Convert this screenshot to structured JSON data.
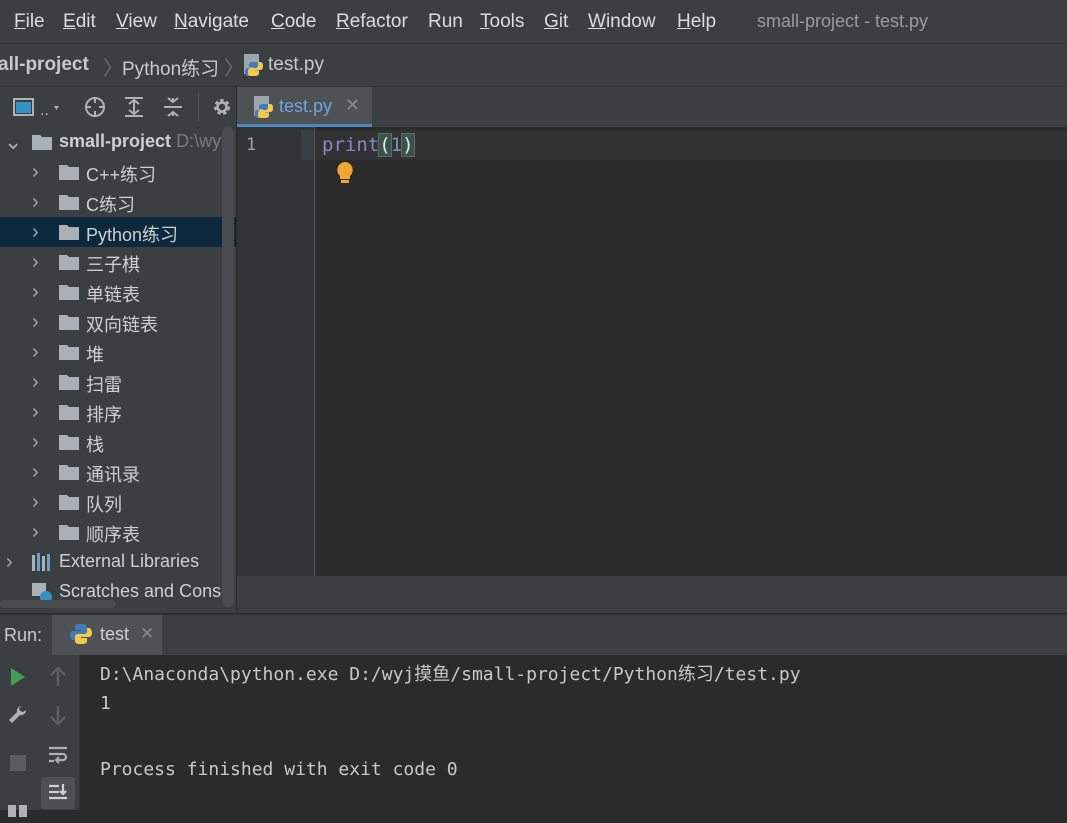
{
  "menu": {
    "items": [
      {
        "label": "File",
        "u": "F",
        "rest": "ile"
      },
      {
        "label": "Edit",
        "u": "E",
        "rest": "dit"
      },
      {
        "label": "View",
        "u": "V",
        "rest": "iew"
      },
      {
        "label": "Navigate",
        "u": "N",
        "rest": "avigate"
      },
      {
        "label": "Code",
        "u": "C",
        "rest": "ode"
      },
      {
        "label": "Refactor",
        "u": "R",
        "rest": "efactor"
      },
      {
        "label": "Run",
        "u": "",
        "rest": "Run"
      },
      {
        "label": "Tools",
        "u": "T",
        "rest": "ools"
      },
      {
        "label": "Git",
        "u": "G",
        "rest": "it"
      },
      {
        "label": "Window",
        "u": "W",
        "rest": "indow"
      },
      {
        "label": "Help",
        "u": "H",
        "rest": "elp"
      }
    ],
    "window_title": "small-project - test.py"
  },
  "breadcrumb": {
    "project": "all-project",
    "folder": "Python练习",
    "file": "test.py"
  },
  "project_tree": {
    "root": {
      "label": "small-project",
      "hint": "D:\\wy"
    },
    "folders": [
      "C++练习",
      "C练习",
      "Python练习",
      "三子棋",
      "单链表",
      "双向链表",
      "堆",
      "扫雷",
      "排序",
      "栈",
      "通讯录",
      "队列",
      "顺序表"
    ],
    "selected_index": 2,
    "external_libraries": "External Libraries",
    "scratches": "Scratches and Conso"
  },
  "editor": {
    "tab": {
      "label": "test.py",
      "close": "✕"
    },
    "line_number": "1",
    "code": {
      "fn": "print",
      "open": "(",
      "num": "1",
      "close": ")"
    }
  },
  "run": {
    "label": "Run:",
    "tab": {
      "label": "test",
      "close": "✕"
    },
    "console": [
      "D:\\Anaconda\\python.exe D:/wyj摸鱼/small-project/Python练习/test.py",
      "1",
      "",
      "Process finished with exit code 0"
    ]
  },
  "colors": {
    "accent": "#4a88c7",
    "selection": "#0d293e",
    "folder": "#a9b0b6",
    "run_green": "#499c54",
    "bulb": "#f0a732"
  }
}
